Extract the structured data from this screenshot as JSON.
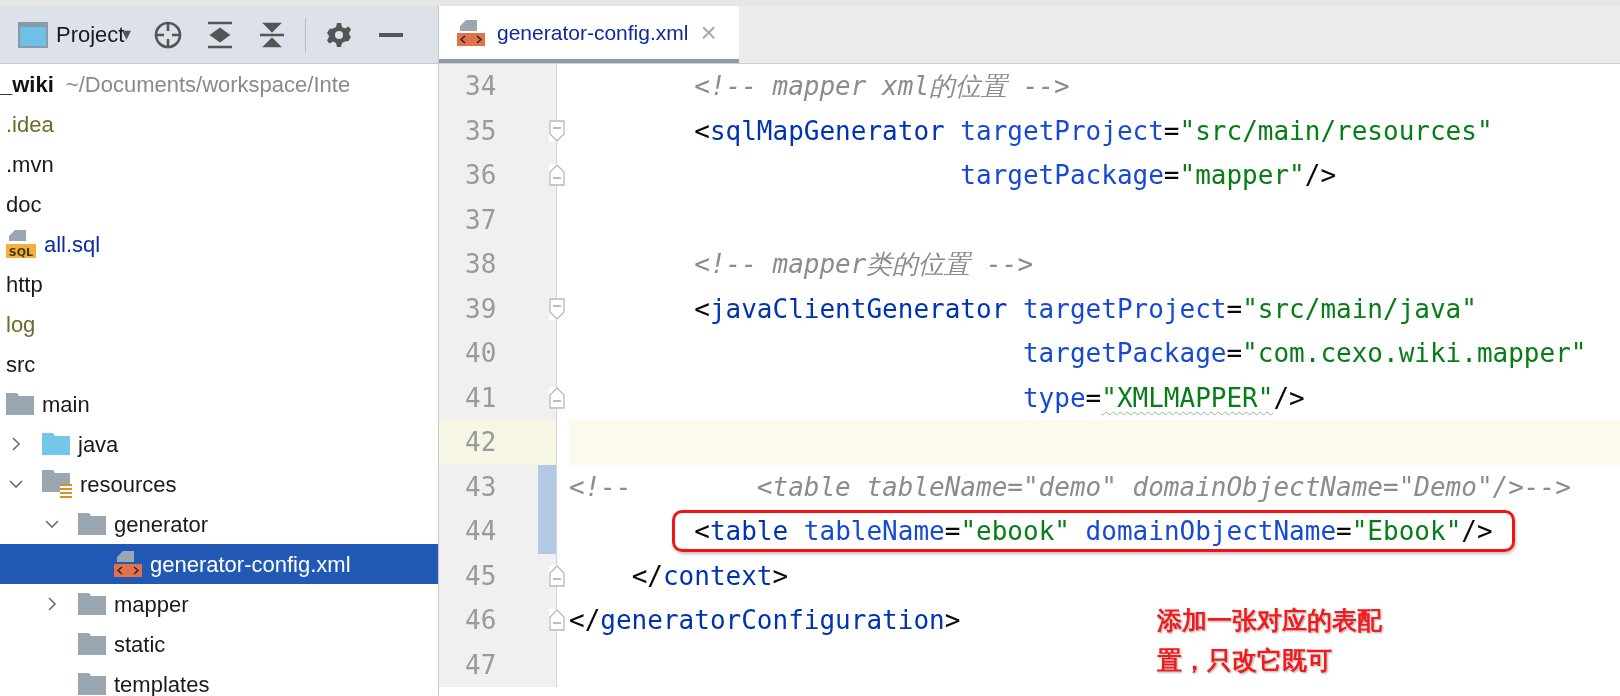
{
  "project_toolbar": {
    "title": "Project",
    "caret": "▾"
  },
  "tree": {
    "root": {
      "name": "_wiki",
      "path": "~/Documents/workspace/Inte"
    },
    "items": [
      {
        "name": ".idea",
        "kind": "plain",
        "color": "#6e6b2c",
        "selected": false
      },
      {
        "name": ".mvn",
        "kind": "plain",
        "color": "#1a1a1a",
        "selected": false
      },
      {
        "name": "doc",
        "kind": "plain",
        "color": "#1a1a1a",
        "selected": false
      },
      {
        "name": "all.sql",
        "kind": "sql",
        "icon_label": "SQL",
        "color": "#0f2a9c",
        "selected": false
      },
      {
        "name": "http",
        "kind": "plain",
        "color": "#1a1a1a",
        "selected": false
      },
      {
        "name": "log",
        "kind": "plain",
        "color": "#6e6b2c",
        "selected": false
      },
      {
        "name": "src",
        "kind": "plain",
        "color": "#1a1a1a",
        "selected": false,
        "children": [
          {
            "name": "main",
            "kind": "folder",
            "color": "#1a1a1a",
            "selected": false,
            "children": [
              {
                "name": "java",
                "kind": "source",
                "color": "#1a1a1a",
                "selected": false,
                "expanded": false
              },
              {
                "name": "resources",
                "kind": "resources",
                "color": "#1a1a1a",
                "selected": false,
                "expanded": true,
                "children": [
                  {
                    "name": "generator",
                    "kind": "folder",
                    "color": "#1a1a1a",
                    "selected": false,
                    "expanded": true,
                    "children": [
                      {
                        "name": "generator-config.xml",
                        "kind": "xml",
                        "color": "#ffffff",
                        "selected": true
                      }
                    ]
                  },
                  {
                    "name": "mapper",
                    "kind": "folder",
                    "color": "#1a1a1a",
                    "selected": false,
                    "expanded": false
                  },
                  {
                    "name": "static",
                    "kind": "folder",
                    "color": "#1a1a1a",
                    "selected": false
                  },
                  {
                    "name": "templates",
                    "kind": "folder",
                    "color": "#1a1a1a",
                    "selected": false
                  }
                ]
              }
            ]
          }
        ]
      }
    ]
  },
  "tabs": [
    {
      "label": "generator-config.xml",
      "selected": true,
      "close": "×"
    }
  ],
  "editor": {
    "lines": [
      {
        "number": "34",
        "tokens": [
          {
            "kind": "comment",
            "text": "        <!-- mapper xml的位置 -->"
          }
        ]
      },
      {
        "number": "35",
        "fold_start": true,
        "tokens": [
          {
            "kind": "punct",
            "text": "        <"
          },
          {
            "kind": "tag",
            "text": "sqlMapGenerator"
          },
          {
            "kind": "attr",
            "text": " targetProject"
          },
          {
            "kind": "punct",
            "text": "="
          },
          {
            "kind": "value",
            "text": "\"src/main/resources\""
          }
        ]
      },
      {
        "number": "36",
        "fold_end": true,
        "tokens": [
          {
            "kind": "attr",
            "text": "                         targetPackage"
          },
          {
            "kind": "punct",
            "text": "="
          },
          {
            "kind": "value",
            "text": "\"mapper\""
          },
          {
            "kind": "punct",
            "text": "/>"
          }
        ]
      },
      {
        "number": "37"
      },
      {
        "number": "38",
        "tokens": [
          {
            "kind": "comment",
            "text": "        <!-- mapper类的位置 -->"
          }
        ]
      },
      {
        "number": "39",
        "fold_start": true,
        "tokens": [
          {
            "kind": "punct",
            "text": "        <"
          },
          {
            "kind": "tag",
            "text": "javaClientGenerator"
          },
          {
            "kind": "attr",
            "text": " targetProject"
          },
          {
            "kind": "punct",
            "text": "="
          },
          {
            "kind": "value",
            "text": "\"src/main/java\""
          }
        ]
      },
      {
        "number": "40",
        "tokens": [
          {
            "kind": "attr",
            "text": "                             targetPackage"
          },
          {
            "kind": "punct",
            "text": "="
          },
          {
            "kind": "value",
            "text": "\"com.cexo.wiki.mapper\""
          }
        ]
      },
      {
        "number": "41",
        "fold_end": true,
        "tokens": [
          {
            "kind": "attr",
            "text": "                             type"
          },
          {
            "kind": "punct",
            "text": "="
          },
          {
            "kind": "value",
            "text": "\"XMLMAPPER\"",
            "typo": true
          },
          {
            "kind": "punct",
            "text": "/>"
          }
        ]
      },
      {
        "number": "42",
        "current": true
      },
      {
        "number": "43",
        "changed": true,
        "tokens": [
          {
            "kind": "comment",
            "text": "<!--        <table tableName=\"demo\" domainObjectName=\"Demo\"/>-->"
          }
        ]
      },
      {
        "number": "44",
        "changed": true,
        "boxed": true,
        "tokens": [
          {
            "kind": "punct",
            "text": "        <"
          },
          {
            "kind": "tag",
            "text": "table"
          },
          {
            "kind": "attr",
            "text": " tableName"
          },
          {
            "kind": "punct",
            "text": "="
          },
          {
            "kind": "value",
            "text": "\"ebook\""
          },
          {
            "kind": "attr",
            "text": " domainObjectName"
          },
          {
            "kind": "punct",
            "text": "="
          },
          {
            "kind": "value",
            "text": "\"Ebook\""
          },
          {
            "kind": "punct",
            "text": "/>"
          }
        ]
      },
      {
        "number": "45",
        "fold_end": true,
        "tokens": [
          {
            "kind": "punct",
            "text": "    </"
          },
          {
            "kind": "tag",
            "text": "context"
          },
          {
            "kind": "punct",
            "text": ">"
          }
        ]
      },
      {
        "number": "46",
        "fold_end": true,
        "tokens": [
          {
            "kind": "punct",
            "text": "</"
          },
          {
            "kind": "tag",
            "text": "generatorConfiguration"
          },
          {
            "kind": "punct",
            "text": ">"
          }
        ]
      },
      {
        "number": "47"
      }
    ]
  },
  "annotation": {
    "text": "添加一张对应的表配置，只改它既可"
  }
}
